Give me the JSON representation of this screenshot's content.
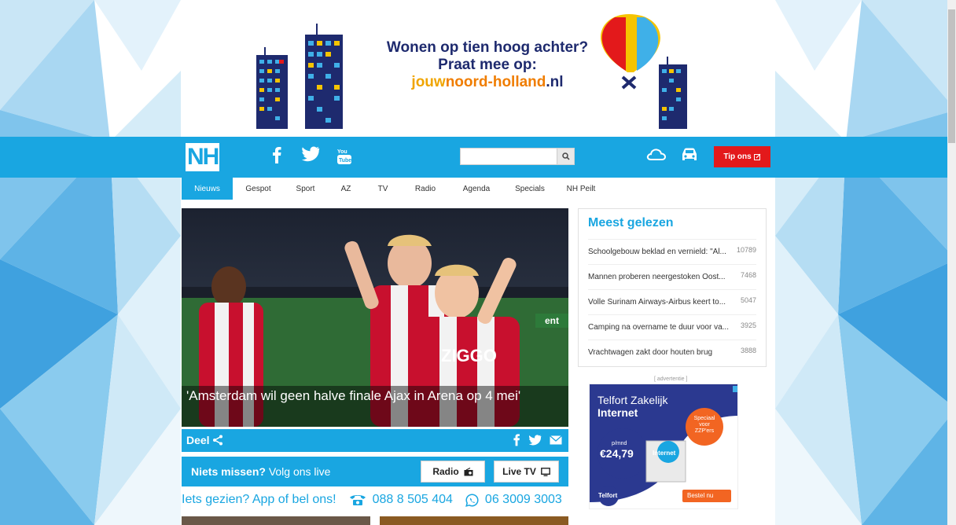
{
  "banner": {
    "line1": "Wonen op tien hoog achter?",
    "line2": "Praat mee op:",
    "url_part1": "jouw",
    "url_part2": "noord-holland",
    "url_part3": ".nl"
  },
  "header": {
    "logo": "NH",
    "search_placeholder": "",
    "tip_label": "Tip ons"
  },
  "nav": {
    "items": [
      "Nieuws",
      "Gespot",
      "Sport",
      "AZ",
      "TV",
      "Radio",
      "Agenda",
      "Specials",
      "NH Peilt"
    ]
  },
  "hero": {
    "title": "'Amsterdam wil geen halve finale Ajax in Arena op 4 mei'"
  },
  "share": {
    "label": "Deel"
  },
  "live": {
    "bold": "Niets missen?",
    "rest": " Volg ons live",
    "radio_label": "Radio",
    "tv_label": "Live TV"
  },
  "contact": {
    "text": "Iets gezien? App of bel ons!",
    "phone": "088 8 505 404",
    "whatsapp": "06 3009 3003"
  },
  "most_read": {
    "title": "Meest gelezen",
    "items": [
      {
        "title": "Schoolgebouw beklad en vernield: \"Al...",
        "count": "10789"
      },
      {
        "title": "Mannen proberen neergestoken Oost...",
        "count": "7468"
      },
      {
        "title": "Volle Surinam Airways-Airbus keert to...",
        "count": "5047"
      },
      {
        "title": "Camping na overname te duur voor va...",
        "count": "3925"
      },
      {
        "title": "Vrachtwagen zakt door houten brug",
        "count": "3888"
      }
    ]
  },
  "ad": {
    "label": "[ advertentie ]",
    "brand": "Telfort Zakelijk",
    "product": "Internet",
    "per": "p/mnd",
    "price": "€24,79",
    "badge": "Speciaal voor ZZP'ers",
    "box_label": "Internet",
    "logo": "Telfort",
    "cta": "Bestel nu"
  },
  "colors": {
    "brand_blue": "#19a6e1",
    "tip_red": "#e3191b"
  }
}
